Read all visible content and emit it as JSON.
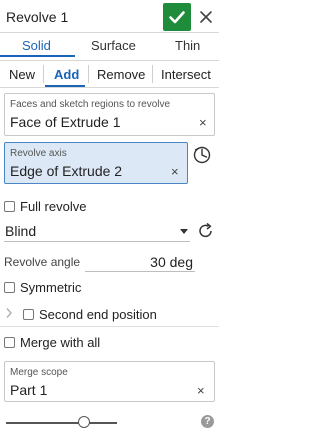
{
  "dialog": {
    "title": "Revolve 1",
    "accent_color": "#1a63b8",
    "ok_color": "#1f8c3b"
  },
  "tabs": [
    {
      "label": "Solid",
      "active": true
    },
    {
      "label": "Surface",
      "active": false
    },
    {
      "label": "Thin",
      "active": false
    }
  ],
  "operations": [
    {
      "label": "New",
      "active": false
    },
    {
      "label": "Add",
      "active": true
    },
    {
      "label": "Remove",
      "active": false
    },
    {
      "label": "Intersect",
      "active": false
    }
  ],
  "faces_field": {
    "label": "Faces and sketch regions to revolve",
    "value": "Face of Extrude 1",
    "clear": "×"
  },
  "axis_field": {
    "label": "Revolve axis",
    "value": "Edge of Extrude 2",
    "clear": "×"
  },
  "full_revolve": {
    "label": "Full revolve",
    "checked": false
  },
  "end_type": {
    "value": "Blind"
  },
  "revolve_angle": {
    "label": "Revolve angle",
    "value": "30 deg"
  },
  "symmetric": {
    "label": "Symmetric",
    "checked": false
  },
  "second_end": {
    "label": "Second end position",
    "checked": false
  },
  "merge_all": {
    "label": "Merge with all",
    "checked": false
  },
  "merge_scope": {
    "label": "Merge scope",
    "value": "Part 1",
    "clear": "×"
  },
  "footer": {
    "help": "?",
    "slider_level": 0.7
  }
}
